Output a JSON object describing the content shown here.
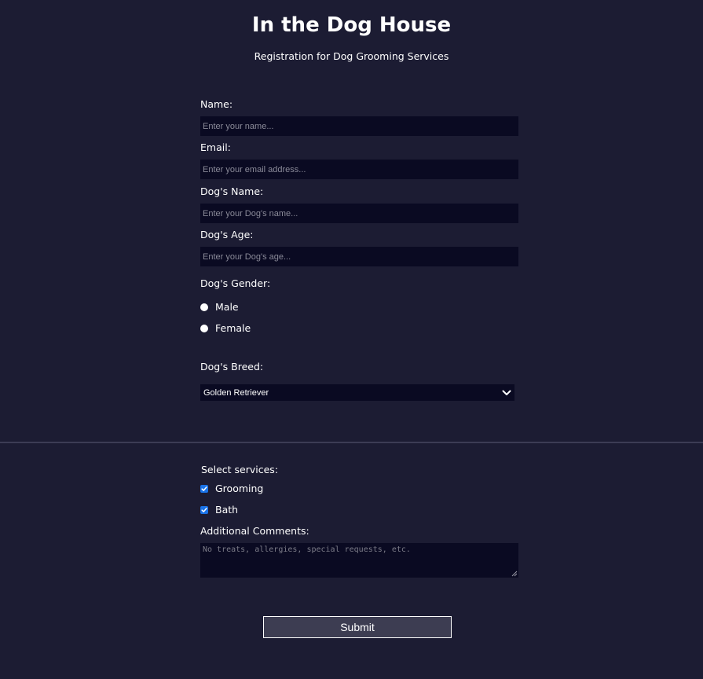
{
  "header": {
    "title": "In the Dog House",
    "subtitle": "Registration for Dog Grooming Services"
  },
  "form": {
    "name": {
      "label": "Name:",
      "placeholder": "Enter your name...",
      "value": ""
    },
    "email": {
      "label": "Email:",
      "placeholder": "Enter your email address...",
      "value": ""
    },
    "dog_name": {
      "label": "Dog's Name:",
      "placeholder": "Enter your Dog's name...",
      "value": ""
    },
    "dog_age": {
      "label": "Dog's Age:",
      "placeholder": "Enter your Dog's age...",
      "value": ""
    },
    "gender": {
      "label": "Dog's Gender:",
      "options": [
        {
          "label": "Male",
          "selected": false
        },
        {
          "label": "Female",
          "selected": false
        }
      ]
    },
    "breed": {
      "label": "Dog's Breed:",
      "selected": "Golden Retriever",
      "icon": "chevron-down-icon"
    },
    "services": {
      "label": "Select services:",
      "options": [
        {
          "label": "Grooming",
          "checked": true
        },
        {
          "label": "Bath",
          "checked": true
        }
      ]
    },
    "comments": {
      "label": "Additional Comments:",
      "placeholder": "No treats, allergies, special requests, etc.",
      "value": ""
    },
    "submit_label": "Submit"
  },
  "colors": {
    "background": "#1c1c33",
    "input_background": "#0a0a22",
    "checkbox_accent": "#1a73e8",
    "button_background": "#3d3d52",
    "divider": "#3c3c55"
  }
}
